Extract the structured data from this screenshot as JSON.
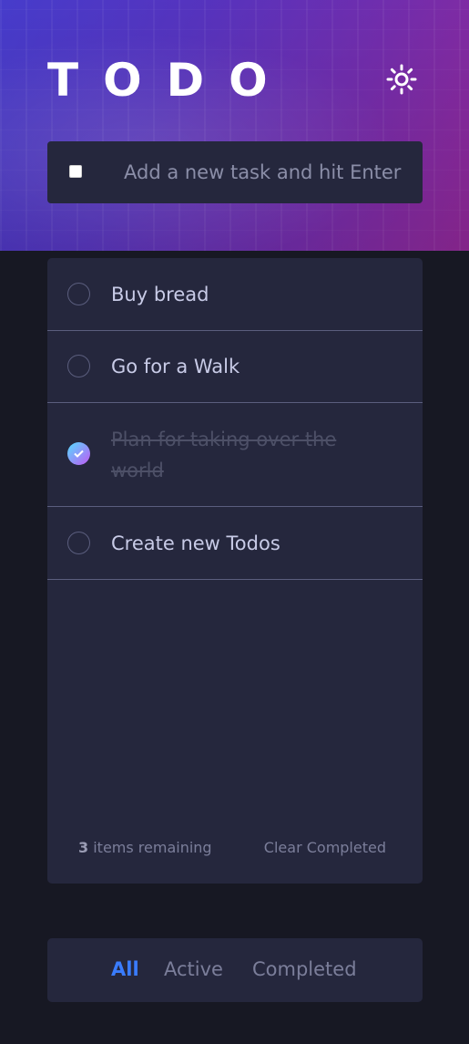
{
  "app": {
    "title": "TODO",
    "theme_toggle_icon": "sun-icon"
  },
  "new_task": {
    "placeholder": "Add a new task and hit Enter",
    "value": ""
  },
  "todos": [
    {
      "text": "Buy bread",
      "completed": false
    },
    {
      "text": "Go for a Walk",
      "completed": false
    },
    {
      "text": "Plan for taking over the world",
      "completed": true
    },
    {
      "text": "Create new Todos",
      "completed": false
    }
  ],
  "footer": {
    "count": "3",
    "count_suffix": " items remaining",
    "clear_label": "Clear Completed"
  },
  "filters": {
    "all": "All",
    "active": "Active",
    "completed": "Completed",
    "selected": "All"
  },
  "colors": {
    "accent": "#3a7cfd",
    "background": "#171823",
    "card": "#25273d",
    "check_gradient_start": "#55ddff",
    "check_gradient_end": "#c058f3"
  }
}
